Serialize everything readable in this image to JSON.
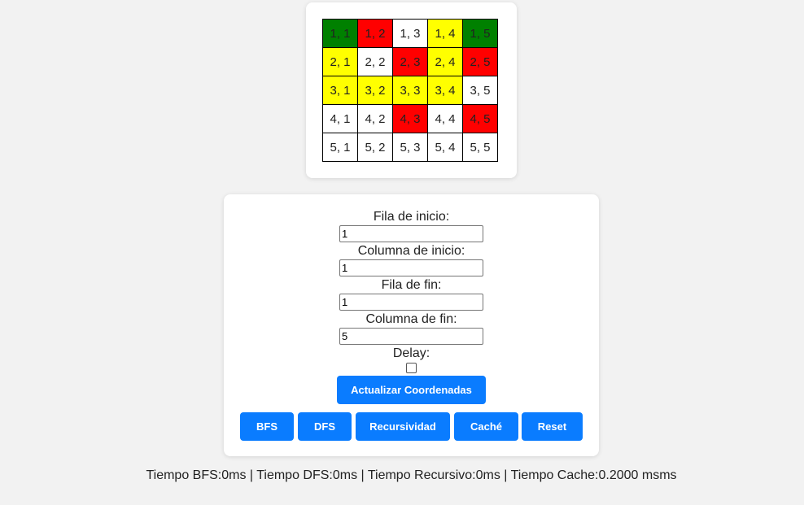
{
  "grid": {
    "rows": [
      [
        {
          "label": "1, 1",
          "color": "#008000"
        },
        {
          "label": "1, 2",
          "color": "#ff0000"
        },
        {
          "label": "1, 3",
          "color": "#ffffff"
        },
        {
          "label": "1, 4",
          "color": "#ffff00"
        },
        {
          "label": "1, 5",
          "color": "#008000"
        }
      ],
      [
        {
          "label": "2, 1",
          "color": "#ffff00"
        },
        {
          "label": "2, 2",
          "color": "#ffffff"
        },
        {
          "label": "2, 3",
          "color": "#ff0000"
        },
        {
          "label": "2, 4",
          "color": "#ffff00"
        },
        {
          "label": "2, 5",
          "color": "#ff0000"
        }
      ],
      [
        {
          "label": "3, 1",
          "color": "#ffff00"
        },
        {
          "label": "3, 2",
          "color": "#ffff00"
        },
        {
          "label": "3, 3",
          "color": "#ffff00"
        },
        {
          "label": "3, 4",
          "color": "#ffff00"
        },
        {
          "label": "3, 5",
          "color": "#ffffff"
        }
      ],
      [
        {
          "label": "4, 1",
          "color": "#ffffff"
        },
        {
          "label": "4, 2",
          "color": "#ffffff"
        },
        {
          "label": "4, 3",
          "color": "#ff0000"
        },
        {
          "label": "4, 4",
          "color": "#ffffff"
        },
        {
          "label": "4, 5",
          "color": "#ff0000"
        }
      ],
      [
        {
          "label": "5, 1",
          "color": "#ffffff"
        },
        {
          "label": "5, 2",
          "color": "#ffffff"
        },
        {
          "label": "5, 3",
          "color": "#ffffff"
        },
        {
          "label": "5, 4",
          "color": "#ffffff"
        },
        {
          "label": "5, 5",
          "color": "#ffffff"
        }
      ]
    ]
  },
  "form": {
    "start_row_label": "Fila de inicio:",
    "start_row_value": "1",
    "start_col_label": "Columna de inicio:",
    "start_col_value": "1",
    "end_row_label": "Fila de fin:",
    "end_row_value": "1",
    "end_col_label": "Columna de fin:",
    "end_col_value": "5",
    "delay_label": "Delay:",
    "delay_checked": false,
    "update_button": "Actualizar Coordenadas"
  },
  "algorithms": {
    "bfs": "BFS",
    "dfs": "DFS",
    "recursive": "Recursividad",
    "cache": "Caché",
    "reset": "Reset"
  },
  "colors": {
    "accent": "#0a7cff",
    "cell_green": "#008000",
    "cell_red": "#ff0000",
    "cell_yellow": "#ffff00",
    "cell_white": "#ffffff"
  },
  "status": {
    "text": "Tiempo BFS:0ms | Tiempo DFS:0ms | Tiempo Recursivo:0ms | Tiempo Cache:0.2000 msms"
  }
}
